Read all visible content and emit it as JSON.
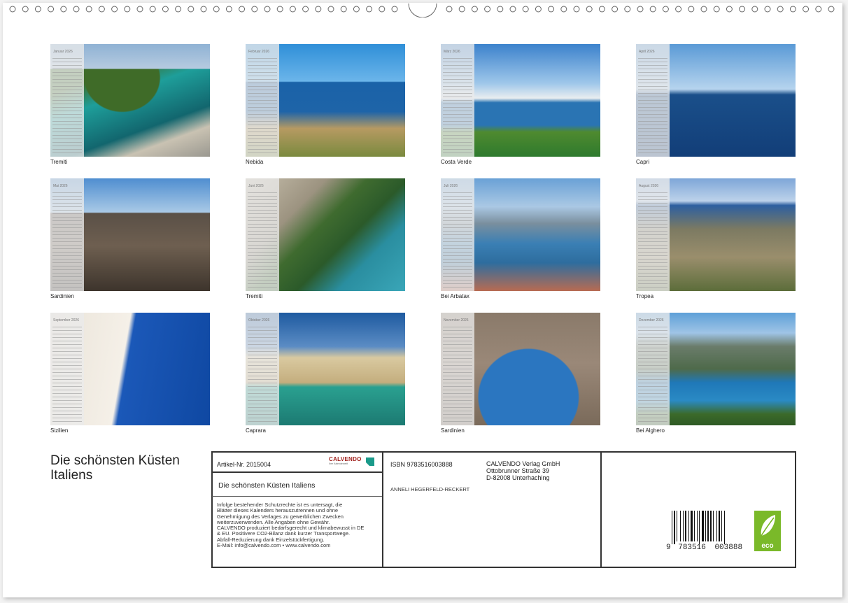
{
  "months": [
    {
      "label": "Januar 2026",
      "caption": "Tremiti"
    },
    {
      "label": "Februar 2026",
      "caption": "Nebida"
    },
    {
      "label": "März 2026",
      "caption": "Costa Verde"
    },
    {
      "label": "April 2026",
      "caption": "Capri"
    },
    {
      "label": "Mai 2026",
      "caption": "Sardinien"
    },
    {
      "label": "Juni 2026",
      "caption": "Tremiti"
    },
    {
      "label": "Juli 2026",
      "caption": "Bei Arbatax"
    },
    {
      "label": "August 2026",
      "caption": "Tropea"
    },
    {
      "label": "September 2026",
      "caption": "Sizilien"
    },
    {
      "label": "Oktober 2026",
      "caption": "Caprara"
    },
    {
      "label": "November 2026",
      "caption": "Sardinien"
    },
    {
      "label": "Dezember 2026",
      "caption": "Bei Alghero"
    }
  ],
  "calendar_title": "Die schönsten Küsten Italiens",
  "info": {
    "article_number": "Artikel-Nr. 2015004",
    "publisher_logo_text": "CALVENDO",
    "publisher_logo_sub": "Ihre Kalenderwelt",
    "product_title": "Die schönsten Küsten Italiens",
    "legal_lines": [
      "Infolge bestehender Schutzrechte ist es untersagt, die",
      "Blätter dieses Kalenders herauszutrennen und ohne",
      "Genehmigung des Verlages zu gewerblichen Zwecken",
      "weiterzuverwenden. Alle Angaben ohne Gewähr.",
      "CALVENDO produziert bedarfsgerecht und klimabewusst in DE",
      "& EU. Positivere CO2-Bilanz dank kurzer Transportwege.",
      "Abfall-Reduzierung dank Einzelstückfertigung.",
      "E-Mail: info@calvendo.com • www.calvendo.com"
    ],
    "isbn": "ISBN 9783516003888",
    "author": "ANNELI HEGERFELD-RECKERT",
    "publisher_name": "CALVENDO Verlag GmbH",
    "publisher_street": "Ottobrunner Straße 39",
    "publisher_city": "D-82008 Unterhaching",
    "barcode_first": "9",
    "barcode_group1": "783516",
    "barcode_group2": "003888",
    "eco_label": "eco"
  },
  "colors": {
    "frame": "#333333",
    "eco_green": "#7ab929",
    "logo_teal": "#1a9a8a"
  }
}
